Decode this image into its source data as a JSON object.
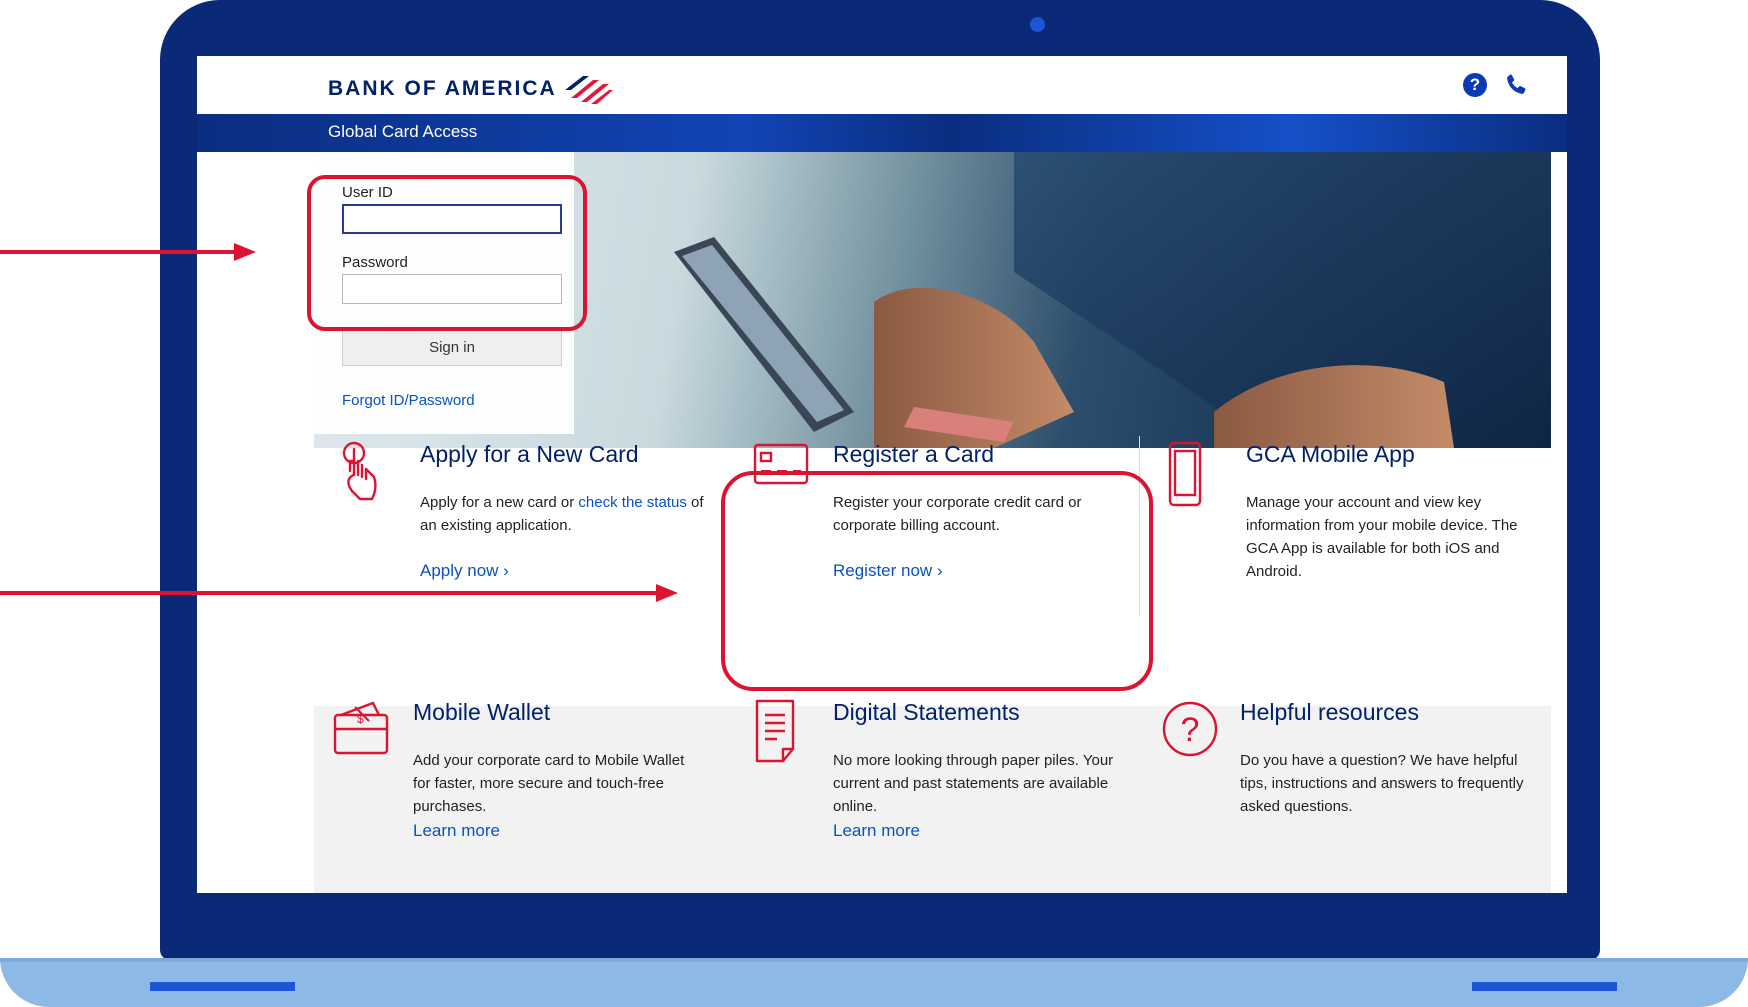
{
  "brand": {
    "name": "BANK OF AMERICA",
    "app_title": "Global Card Access"
  },
  "header": {
    "help_icon": "question-circle-icon",
    "phone_icon": "phone-icon",
    "help_glyph": "?"
  },
  "login": {
    "user_id_label": "User ID",
    "user_id_value": "",
    "password_label": "Password",
    "password_value": "",
    "sign_in_label": "Sign in",
    "forgot_label": "Forgot ID/Password"
  },
  "features": [
    {
      "title": "Apply for a New Card",
      "text_before": "Apply for a new card or ",
      "text_link": "check the status",
      "text_after": " of an existing application.",
      "link": "Apply now ›",
      "icon": "tap-finger-icon"
    },
    {
      "title": "Register a Card",
      "text": "Register your corporate credit card or corporate billing account.",
      "link": "Register now ›",
      "icon": "card-icon"
    },
    {
      "title": "GCA Mobile App",
      "text": "Manage your account and view key information from your mobile device. The GCA App is available for both iOS and Android.",
      "icon": "mobile-phone-icon"
    },
    {
      "title": "Mobile Wallet",
      "text": "Add your corporate card to Mobile Wallet for faster, more secure and touch-free purchases.",
      "link": "Learn more",
      "icon": "wallet-icon"
    },
    {
      "title": "Digital Statements",
      "text": "No more looking through paper piles. Your current and past statements are available online.",
      "link": "Learn more",
      "icon": "document-icon"
    },
    {
      "title": "Helpful resources",
      "text": "Do you have a question? We have helpful tips, instructions and answers to frequently asked questions.",
      "icon": "question-mark-circle-icon",
      "glyph": "?"
    }
  ],
  "colors": {
    "brand_navy": "#012169",
    "link_blue": "#0a52c0",
    "highlight_red": "#dc1431",
    "laptop_frame": "#0a2a78",
    "laptop_base": "#8db9e6"
  }
}
